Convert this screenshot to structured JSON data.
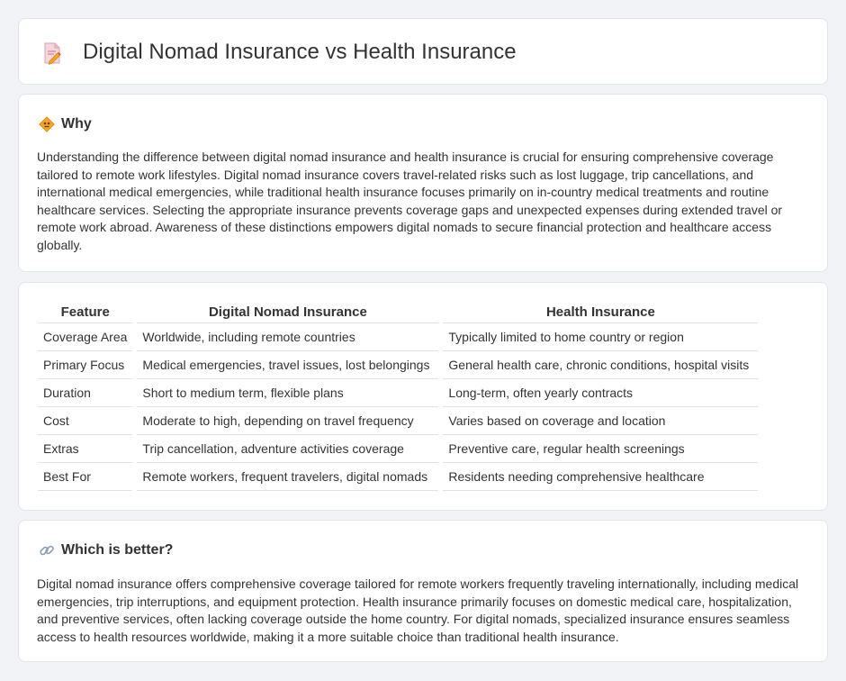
{
  "header": {
    "title": "Digital Nomad Insurance vs Health Insurance",
    "icon": "document-pencil-icon"
  },
  "why": {
    "heading": "Why",
    "icon": "diamond-road-sign-icon",
    "text": "Understanding the difference between digital nomad insurance and health insurance is crucial for ensuring comprehensive coverage tailored to remote work lifestyles. Digital nomad insurance covers travel-related risks such as lost luggage, trip cancellations, and international medical emergencies, while traditional health insurance focuses primarily on in-country medical treatments and routine healthcare services. Selecting the appropriate insurance prevents coverage gaps and unexpected expenses during extended travel or remote work abroad. Awareness of these distinctions empowers digital nomads to secure financial protection and healthcare access globally."
  },
  "table": {
    "headers": [
      "Feature",
      "Digital Nomad Insurance",
      "Health Insurance"
    ],
    "rows": [
      [
        "Coverage Area",
        "Worldwide, including remote countries",
        "Typically limited to home country or region"
      ],
      [
        "Primary Focus",
        "Medical emergencies, travel issues, lost belongings",
        "General health care, chronic conditions, hospital visits"
      ],
      [
        "Duration",
        "Short to medium term, flexible plans",
        "Long-term, often yearly contracts"
      ],
      [
        "Cost",
        "Moderate to high, depending on travel frequency",
        "Varies based on coverage and location"
      ],
      [
        "Extras",
        "Trip cancellation, adventure activities coverage",
        "Preventive care, regular health screenings"
      ],
      [
        "Best For",
        "Remote workers, frequent travelers, digital nomads",
        "Residents needing comprehensive healthcare"
      ]
    ]
  },
  "better": {
    "heading": "Which is better?",
    "icon": "link-icon",
    "text": "Digital nomad insurance offers comprehensive coverage tailored for remote workers frequently traveling internationally, including medical emergencies, trip interruptions, and equipment protection. Health insurance primarily focuses on domestic medical care, hospitalization, and preventive services, often lacking coverage outside the home country. For digital nomads, specialized insurance ensures seamless access to health resources worldwide, making it a more suitable choice than traditional health insurance."
  },
  "colors": {
    "background": "#f2f3f7",
    "card": "#ffffff",
    "border": "#e1e4ea",
    "accent": "#f5a623"
  }
}
